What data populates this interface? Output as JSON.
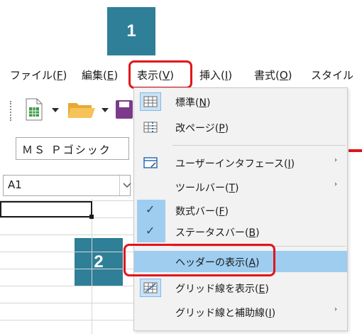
{
  "steps": {
    "step1": "1",
    "step2": "2"
  },
  "menubar": {
    "file": {
      "text": "ファイル(",
      "key": "F",
      "end": ")"
    },
    "edit": {
      "text": "編集(",
      "key": "E",
      "end": ")"
    },
    "view": {
      "text": "表示(",
      "key": "V",
      "end": ")"
    },
    "insert": {
      "text": "挿入(",
      "key": "I",
      "end": ")"
    },
    "format": {
      "text": "書式(",
      "key": "O",
      "end": ")"
    },
    "style": {
      "text": "スタイル"
    }
  },
  "toolbar": {
    "font_name": "ＭＳ Ｐゴシック"
  },
  "namebox": {
    "value": "A1"
  },
  "view_menu": {
    "items": [
      {
        "text": "標準(",
        "key": "N",
        "end": ")",
        "icon": "grid-normal-icon"
      },
      {
        "text": "改ページ(",
        "key": "P",
        "end": ")",
        "icon": "page-break-icon"
      },
      {
        "text": "ユーザーインタフェース(",
        "key": "I",
        "end": ")",
        "icon": "user-interface-icon",
        "submenu": "›"
      },
      {
        "text": "ツールバー(",
        "key": "T",
        "end": ")",
        "submenu": "›"
      },
      {
        "text": "数式バー(",
        "key": "F",
        "end": ")",
        "checked": true
      },
      {
        "text": "ステータスバー(",
        "key": "B",
        "end": ")",
        "checked": true
      },
      {
        "text": "ヘッダーの表示(",
        "key": "A",
        "end": ")",
        "highlighted": true
      },
      {
        "text": "グリッド線を表示(",
        "key": "E",
        "end": ")",
        "icon": "grid-lines-icon"
      },
      {
        "text": "グリッド線と補助線(",
        "key": "I",
        "end": ")",
        "submenu": "›"
      }
    ]
  },
  "colors": {
    "badge": "#2e7f97",
    "highlight_border": "#e2141b",
    "menu_hover": "#9ecdf0"
  }
}
